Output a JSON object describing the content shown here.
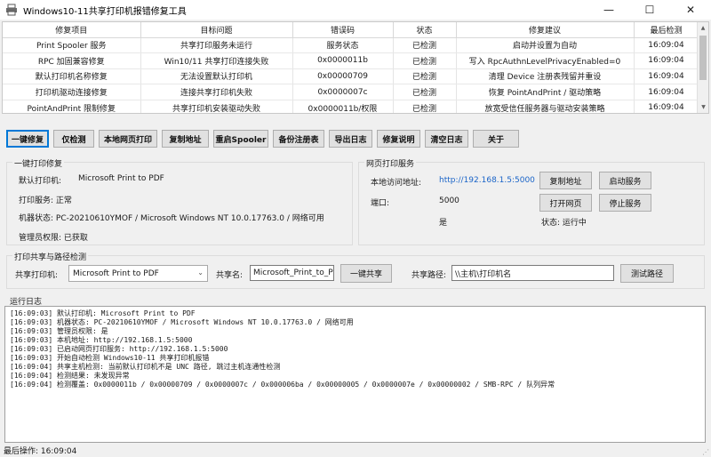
{
  "window": {
    "title": "Windows10-11共享打印机报错修复工具",
    "min_glyph": "—",
    "max_glyph": "☐",
    "close_glyph": "✕"
  },
  "grid": {
    "columns": [
      "修复项目",
      "目标问题",
      "错误码",
      "状态",
      "修复建议",
      "最后检测"
    ],
    "rows": [
      [
        "Print Spooler 服务",
        "共享打印服务未运行",
        "服务状态",
        "已检测",
        "启动并设置为自动",
        "16:09:04"
      ],
      [
        "RPC 加固兼容修复",
        "Win10/11 共享打印连接失败",
        "0x0000011b",
        "已检测",
        "写入 RpcAuthnLevelPrivacyEnabled=0",
        "16:09:04"
      ],
      [
        "默认打印机名称修复",
        "无法设置默认打印机",
        "0x00000709",
        "已检测",
        "清理 Device 注册表残留并重设",
        "16:09:04"
      ],
      [
        "打印机驱动连接修复",
        "连接共享打印机失败",
        "0x0000007c",
        "已检测",
        "恢复 PointAndPrint / 驱动策略",
        "16:09:04"
      ],
      [
        "PointAndPrint 限制修复",
        "共享打印机安装驱动失败",
        "0x0000011b/权限",
        "已检测",
        "放宽受信任服务器与驱动安装策略",
        "16:09:04"
      ]
    ]
  },
  "toolbar": {
    "buttons": [
      "一键修复",
      "仅检测",
      "本地网页打印",
      "复制地址",
      "重启Spooler",
      "备份注册表",
      "导出日志",
      "修复说明",
      "清空日志",
      "关于"
    ]
  },
  "repair_group": {
    "legend": "一键打印修复",
    "default_printer_label": "默认打印机:",
    "default_printer_value": "Microsoft Print to PDF",
    "print_service": "打印服务: 正常",
    "machine_status": "机器状态: PC-20210610YMOF / Microsoft Windows NT 10.0.17763.0 / 网络可用",
    "admin": "管理员权限: 已获取"
  },
  "web_group": {
    "legend": "网页打印服务",
    "url_label": "本地访问地址:",
    "url_value": "http://192.168.1.5:5000",
    "port_label": "端口:",
    "port_value": "5000",
    "yes_value": "是",
    "copy_button": "复制地址",
    "start_button": "启动服务",
    "open_button": "打开网页",
    "stop_button": "停止服务",
    "status": "状态: 运行中"
  },
  "share_group": {
    "legend": "打印共享与路径检测",
    "printer_label": "共享打印机:",
    "printer_value": "Microsoft Print to PDF",
    "share_name_label": "共享名:",
    "share_name_value": "Microsoft_Print_to_PDF",
    "share_button": "一键共享",
    "path_label": "共享路径:",
    "path_value": "\\\\主机\\打印机名",
    "test_button": "测试路径"
  },
  "log": {
    "label": "运行日志",
    "lines": [
      "[16:09:03] 默认打印机: Microsoft Print to PDF",
      "[16:09:03] 机器状态: PC-20210610YMOF / Microsoft Windows NT 10.0.17763.0 / 网络可用",
      "[16:09:03] 管理员权限: 是",
      "[16:09:03] 本机地址: http://192.168.1.5:5000",
      "[16:09:03] 已启动网页打印服务: http://192.168.1.5:5000",
      "[16:09:03] 开始自动检测 Windows10-11 共享打印机报错",
      "[16:09:04] 共享主机检测: 当前默认打印机不是 UNC 路径, 跳过主机连通性检测",
      "[16:09:04] 检测结果: 未发现异常",
      "[16:09:04] 检测覆盖: 0x0000011b / 0x00000709 / 0x0000007c / 0x000006ba / 0x00000005 / 0x0000007e / 0x00000002 / SMB-RPC / 队列异常"
    ]
  },
  "statusbar": {
    "text": "最后操作: 16:09:04"
  },
  "colors": {
    "accent": "#0078d7",
    "link": "#1a64c8",
    "window_bg": "#f0f0f0"
  }
}
